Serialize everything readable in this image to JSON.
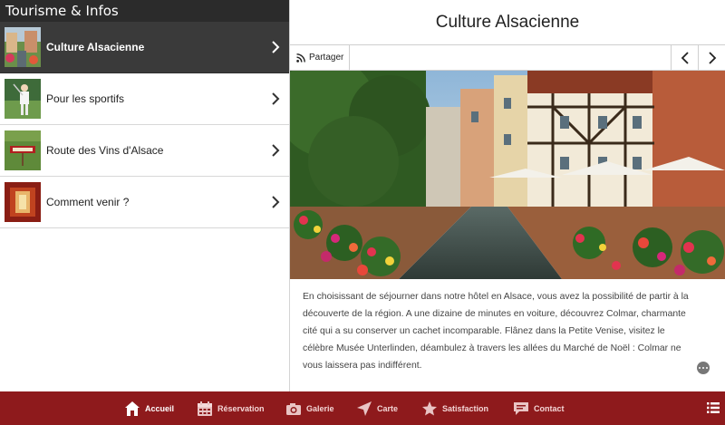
{
  "sidebar": {
    "header": "Tourisme & Infos",
    "items": [
      {
        "label": "Culture Alsacienne",
        "active": true
      },
      {
        "label": "Pour les sportifs",
        "active": false
      },
      {
        "label": "Route des Vins d'Alsace",
        "active": false
      },
      {
        "label": "Comment venir ?",
        "active": false
      }
    ]
  },
  "main": {
    "title": "Culture Alsacienne",
    "share_label": "Partager",
    "description": "En choisissant de séjourner dans notre hôtel en Alsace, vous avez la possibilité de partir à la découverte de la région. A une dizaine de minutes en voiture, découvrez Colmar, charmante cité qui a su conserver un cachet incomparable. Flânez dans la Petite Venise, visitez le célèbre Musée Unterlinden, déambulez à travers les allées du Marché de Noël : Colmar ne vous laissera pas indifférent."
  },
  "bottom_nav": {
    "tabs": [
      {
        "label": "Accueil",
        "icon": "home-icon",
        "active": true
      },
      {
        "label": "Réservation",
        "icon": "calendar-icon",
        "active": false
      },
      {
        "label": "Galerie",
        "icon": "camera-icon",
        "active": false
      },
      {
        "label": "Carte",
        "icon": "send-icon",
        "active": false
      },
      {
        "label": "Satisfaction",
        "icon": "star-icon",
        "active": false
      },
      {
        "label": "Contact",
        "icon": "chat-icon",
        "active": false
      }
    ]
  },
  "colors": {
    "header_bg": "#2b2b2b",
    "active_item_bg": "#3a3a3a",
    "bottom_bar_bg": "#8e1a1c"
  }
}
